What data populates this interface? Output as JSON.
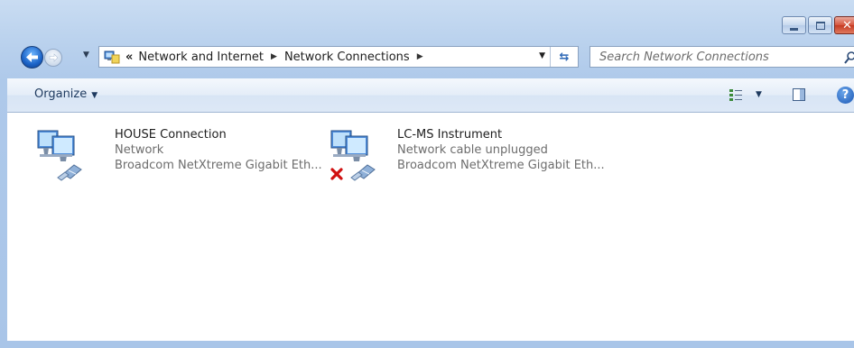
{
  "window": {
    "controls": {
      "minimize_icon": "minimize-icon",
      "maximize_icon": "maximize-icon",
      "close_glyph": "✕"
    }
  },
  "address": {
    "overflow": "«",
    "crumbs": [
      "Network and Internet",
      "Network Connections"
    ]
  },
  "search": {
    "placeholder": "Search Network Connections"
  },
  "toolbar": {
    "organize_label": "Organize"
  },
  "connections": [
    {
      "name": "HOUSE Connection",
      "status": "Network",
      "adapter": "Broadcom NetXtreme Gigabit Eth...",
      "unplugged": false
    },
    {
      "name": "LC-MS Instrument",
      "status": "Network cable unplugged",
      "adapter": "Broadcom NetXtreme Gigabit Eth...",
      "unplugged": true
    }
  ],
  "colors": {
    "frame": "#bcd3ee",
    "status_text": "#6d6d6d",
    "error_x": "#d01010"
  }
}
